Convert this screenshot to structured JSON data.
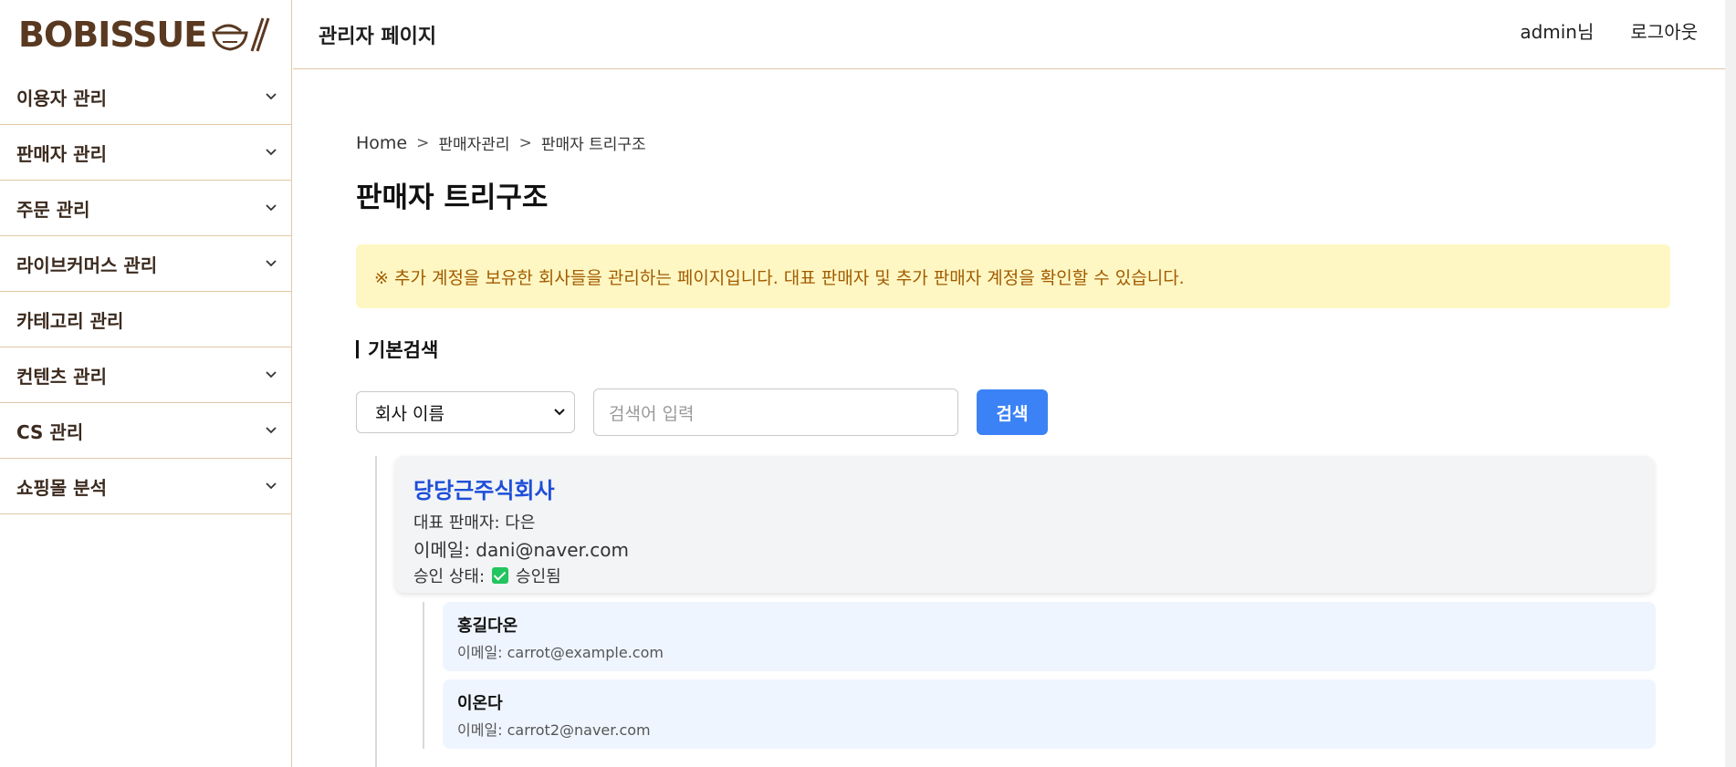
{
  "brand": {
    "name": "BOBISSUE",
    "logo_icon": "rice-bowl-chopsticks-icon",
    "color": "#5a3921"
  },
  "sidebar": {
    "items": [
      {
        "label": "이용자 관리",
        "has_children": true
      },
      {
        "label": "판매자 관리",
        "has_children": true
      },
      {
        "label": "주문 관리",
        "has_children": true
      },
      {
        "label": "라이브커머스 관리",
        "has_children": true
      },
      {
        "label": "카테고리 관리",
        "has_children": false
      },
      {
        "label": "컨텐츠 관리",
        "has_children": true
      },
      {
        "label": "CS 관리",
        "has_children": true
      },
      {
        "label": "쇼핑몰 분석",
        "has_children": true
      }
    ]
  },
  "header": {
    "title": "관리자 페이지",
    "user": "admin님",
    "logout": "로그아웃"
  },
  "breadcrumb": [
    "Home",
    "판매자관리",
    "판매자 트리구조"
  ],
  "page": {
    "title": "판매자 트리구조",
    "notice": "※ 추가 계정을 보유한 회사들을 관리하는 페이지입니다. 대표 판매자 및 추가 판매자 계정을 확인할 수 있습니다.",
    "section_title": "기본검색"
  },
  "search": {
    "selected_option": "회사 이름",
    "placeholder": "검색어 입력",
    "button": "검색"
  },
  "company": {
    "name": "당당근주식회사",
    "rep_line": "대표 판매자: 다은",
    "email_line": "이메일: dani@naver.com",
    "status_label": "승인 상태:",
    "status_value": "승인됨",
    "sub_sellers": [
      {
        "name": "홍길다온",
        "email": "이메일: carrot@example.com"
      },
      {
        "name": "이온다",
        "email": "이메일: carrot2@naver.com"
      }
    ]
  },
  "colors": {
    "accent_blue": "#3b82f6",
    "company_link": "#1d4ed8",
    "notice_bg": "#fef7c3",
    "notice_text": "#a25b00",
    "border": "#e2c6a6"
  }
}
